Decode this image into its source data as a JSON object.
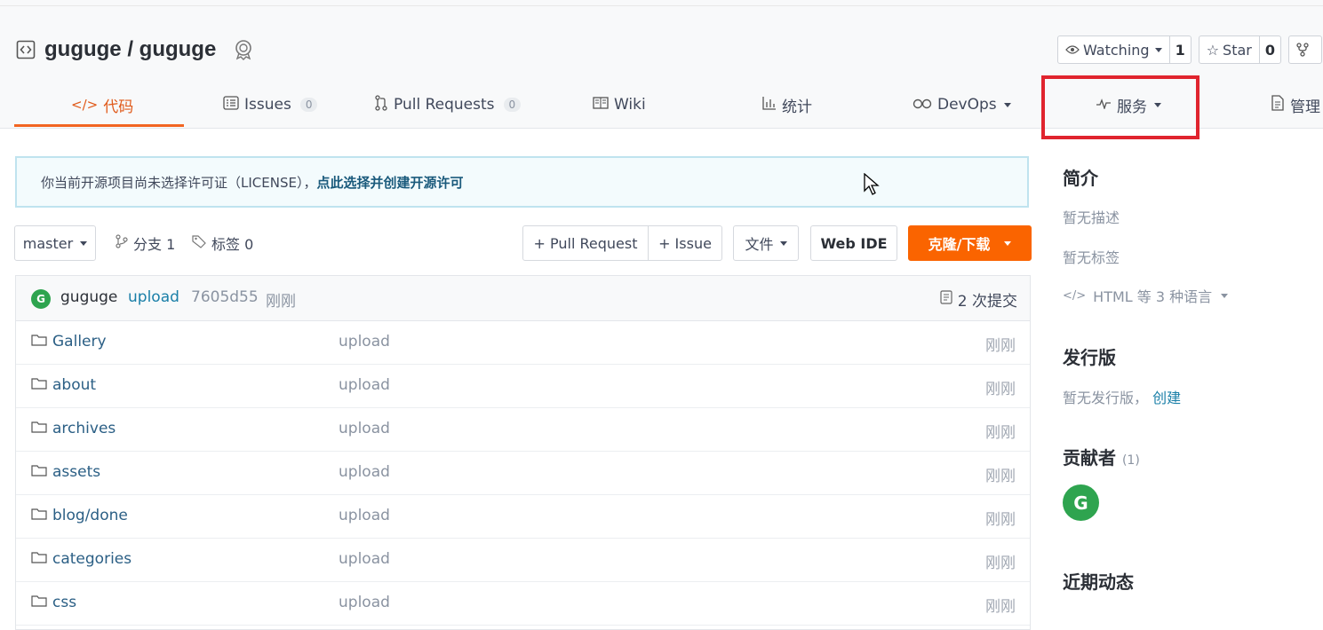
{
  "repo": {
    "title": "guguge / guguge"
  },
  "actions": {
    "watch": {
      "label": "Watching",
      "count": "1"
    },
    "star": {
      "label": "Star",
      "count": "0"
    }
  },
  "tabs": [
    {
      "label": "代码",
      "icon": "code-icon"
    },
    {
      "label": "Issues",
      "count": "0",
      "icon": "issues-icon"
    },
    {
      "label": "Pull Requests",
      "count": "0",
      "icon": "pull-request-icon"
    },
    {
      "label": "Wiki",
      "icon": "book-icon"
    },
    {
      "label": "统计",
      "icon": "chart-icon"
    },
    {
      "label": "DevOps",
      "icon": "infinity-icon"
    },
    {
      "label": "服务",
      "icon": "pulse-icon"
    },
    {
      "label": "管理",
      "icon": "document-icon"
    }
  ],
  "notice": {
    "text": "你当前开源项目尚未选择许可证（LICENSE），",
    "link": "点此选择并创建开源许可"
  },
  "toolbar": {
    "branch": "master",
    "branches": "分支 1",
    "tags": "标签 0",
    "pull_request": "+ Pull Request",
    "issue": "+ Issue",
    "file": "文件",
    "webide": "Web IDE",
    "clone": "克隆/下载"
  },
  "commit": {
    "avatar": "G",
    "user": "guguge",
    "message": "upload",
    "hash": "7605d55",
    "time": "刚刚",
    "count": "2 次提交"
  },
  "files": [
    {
      "name": "Gallery",
      "message": "upload",
      "time": "刚刚"
    },
    {
      "name": "about",
      "message": "upload",
      "time": "刚刚"
    },
    {
      "name": "archives",
      "message": "upload",
      "time": "刚刚"
    },
    {
      "name": "assets",
      "message": "upload",
      "time": "刚刚"
    },
    {
      "name": "blog/done",
      "message": "upload",
      "time": "刚刚"
    },
    {
      "name": "categories",
      "message": "upload",
      "time": "刚刚"
    },
    {
      "name": "css",
      "message": "upload",
      "time": "刚刚"
    }
  ],
  "sidebar": {
    "intro_title": "简介",
    "no_desc": "暂无描述",
    "no_tags": "暂无标签",
    "languages": "HTML 等 3 种语言",
    "release_title": "发行版",
    "no_release": "暂无发行版，",
    "create": "创建",
    "contrib_title": "贡献者",
    "contrib_count": "(1)",
    "contrib_avatar": "G",
    "activity_title": "近期动态"
  },
  "colors": {
    "accent": "#fa6400",
    "highlight": "#e0242e",
    "link": "#1a7fa8"
  }
}
